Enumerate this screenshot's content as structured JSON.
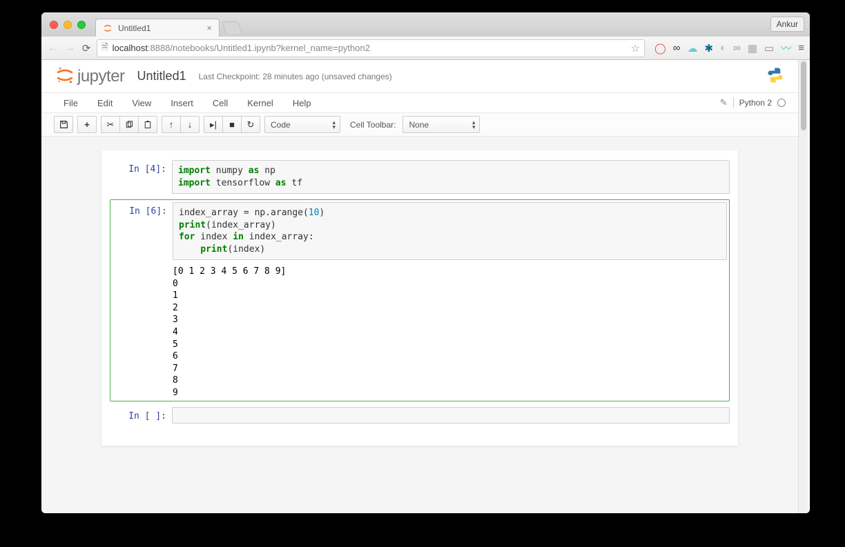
{
  "browser": {
    "tab_title": "Untitled1",
    "profile": "Ankur",
    "url_host": "localhost",
    "url_port": ":8888",
    "url_path": "/notebooks/Untitled1.ipynb?kernel_name=python2"
  },
  "header": {
    "brand": "jupyter",
    "title": "Untitled1",
    "checkpoint": "Last Checkpoint: 28 minutes ago (unsaved changes)"
  },
  "menubar": {
    "items": [
      "File",
      "Edit",
      "View",
      "Insert",
      "Cell",
      "Kernel",
      "Help"
    ],
    "kernel_name": "Python 2"
  },
  "toolbar": {
    "cell_type": "Code",
    "toolbar_label": "Cell Toolbar:",
    "cell_toolbar": "None"
  },
  "cells": [
    {
      "prompt": "In [4]:",
      "source_html": "<span class='kw'>import</span> numpy <span class='kw'>as</span> np\n<span class='kw'>import</span> tensorflow <span class='kw'>as</span> tf",
      "selected": false
    },
    {
      "prompt": "In [6]:",
      "source_html": "index_array = np.arange(<span class='num'>10</span>)\n<span class='kw'>print</span>(index_array)\n<span class='kw'>for</span> index <span class='kw'>in</span> index_array:\n    <span class='kw'>print</span>(index)",
      "output": "[0 1 2 3 4 5 6 7 8 9]\n0\n1\n2\n3\n4\n5\n6\n7\n8\n9",
      "selected": true
    },
    {
      "prompt": "In [ ]:",
      "source_html": "",
      "selected": false
    }
  ]
}
